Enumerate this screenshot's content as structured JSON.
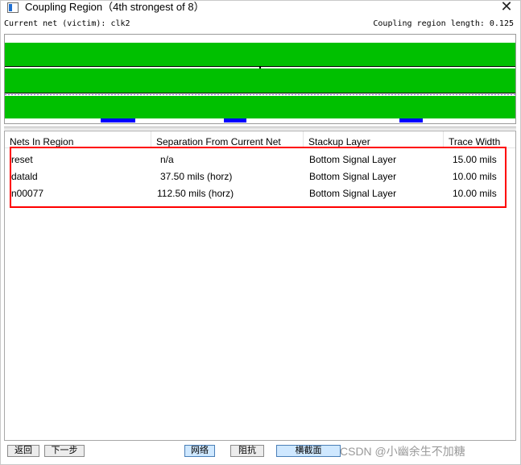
{
  "window": {
    "title": "Coupling Region（4th strongest of 8）",
    "close_label": "✕"
  },
  "info": {
    "current_net": "Current net (victim): clk2",
    "region_length": "Coupling region length: 0.125"
  },
  "colors": {
    "copper": "#00c000",
    "trace_line": "#000000",
    "via_marker": "#0000ff",
    "highlight_box": "#ff0000"
  },
  "table": {
    "columns": [
      "Nets In Region",
      "Separation From Current Net",
      "Stackup Layer",
      "Trace Width"
    ],
    "rows": [
      [
        "reset",
        "n/a",
        "Bottom Signal Layer",
        "15.00 mils"
      ],
      [
        "datald",
        "37.50 mils (horz)",
        "Bottom Signal Layer",
        "10.00 mils"
      ],
      [
        "n00077",
        "112.50 mils (horz)",
        "Bottom Signal Layer",
        "10.00 mils"
      ]
    ]
  },
  "buttons": {
    "back": "返回",
    "next": "下一步",
    "net": "网络",
    "impedance": "阻抗",
    "cross_section": "横截面"
  },
  "watermark": "CSDN @小幽余生不加糖"
}
